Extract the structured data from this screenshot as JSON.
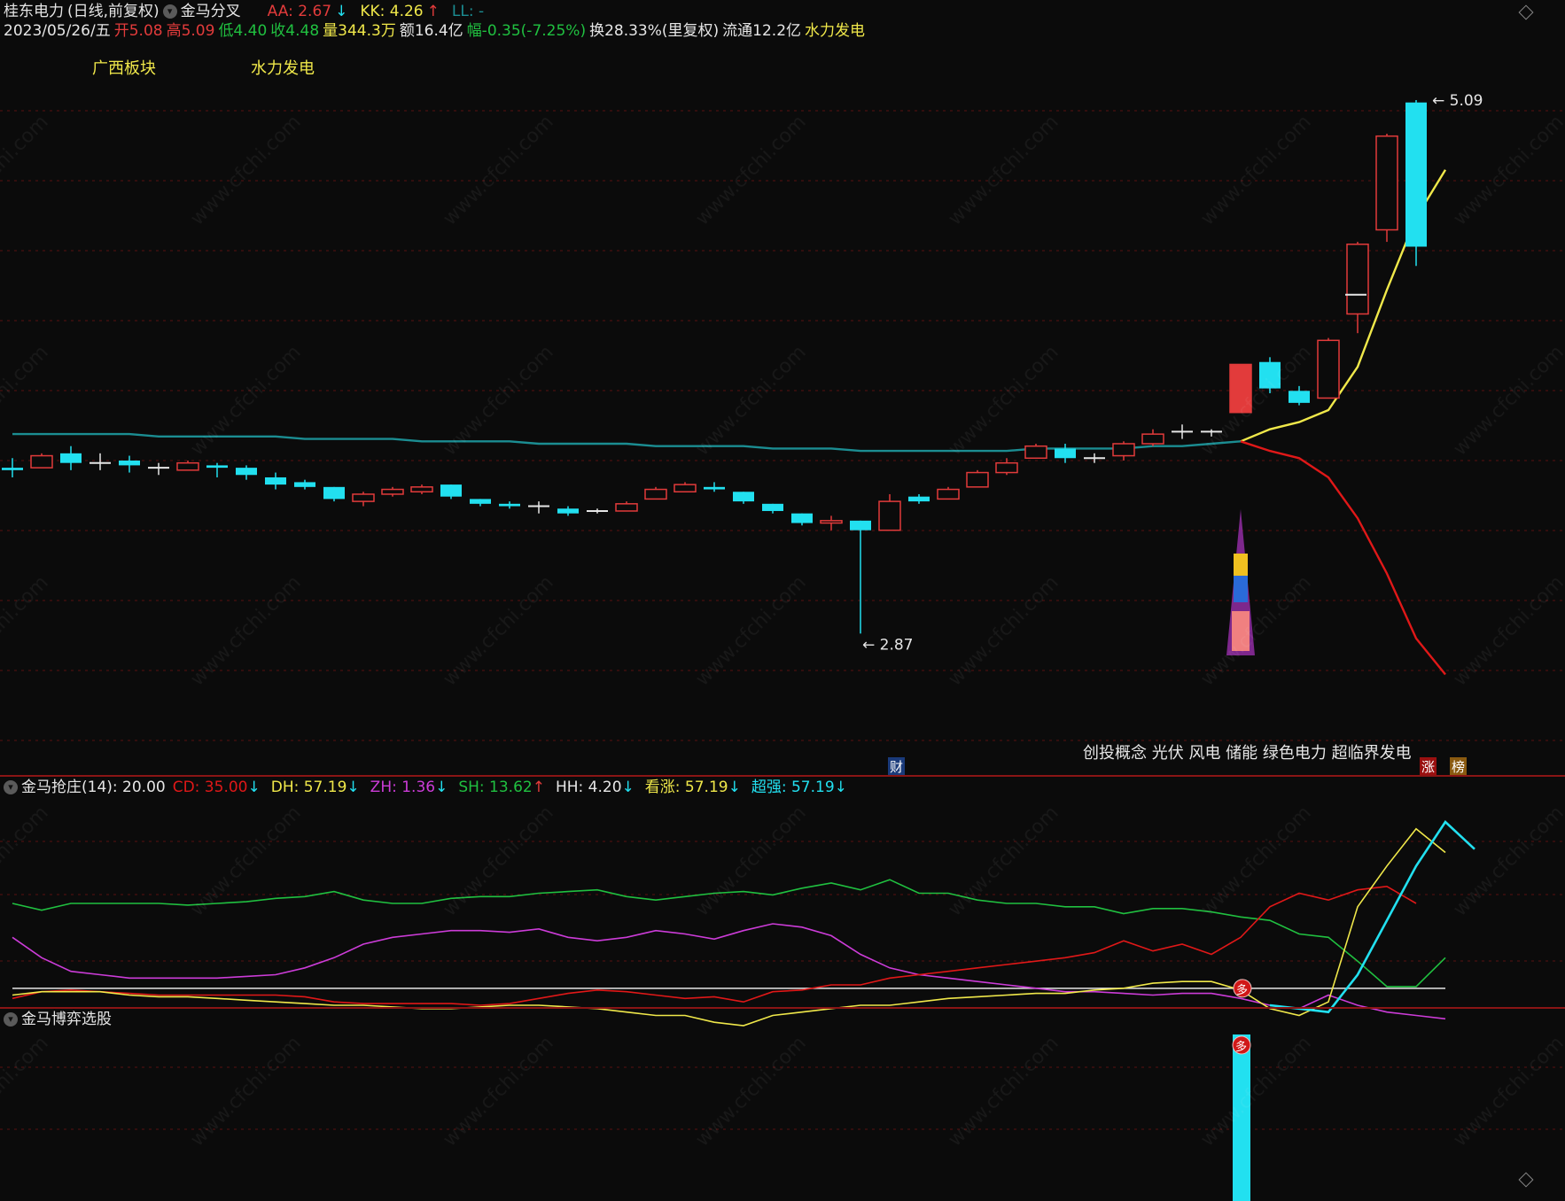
{
  "header": {
    "stock_name": "桂东电力",
    "period": "(日线,前复权)",
    "indicator_name": "金马分叉",
    "aa_label": "AA: 2.67",
    "kk_label": "KK: 4.26",
    "ll_label": "LL: -",
    "date": "2023/05/26/五",
    "open": "开5.08",
    "high": "高5.09",
    "low": "低4.40",
    "close": "收4.48",
    "volume": "量344.3万",
    "amount": "额16.4亿",
    "change": "幅-0.35(-7.25%)",
    "turnover": "换28.33%(里复权)",
    "float": "流通12.2亿",
    "sector": "水力发电"
  },
  "main": {
    "tag_region": "广西板块",
    "tag_industry": "水力发电",
    "concepts": "创投概念 光伏 风电 储能 绿色电力 超临界发电",
    "badge_cai": "财",
    "badge_zhang": "涨",
    "badge_bang": "榜",
    "high_label": "5.09",
    "low_label": "2.87"
  },
  "sub1": {
    "title": "金马抢庄(14)",
    "val": ": 20.00",
    "cd": "CD: 35.00",
    "dh": "DH: 57.19",
    "zh": "ZH: 1.36",
    "sh": "SH: 13.62",
    "hh": "HH: 4.20",
    "kz": "看涨: 57.19",
    "cq": "超强: 57.19",
    "marker": "多"
  },
  "sub2": {
    "title": "金马博弈选股",
    "marker": "多"
  },
  "watermark": "www.cfchi.com",
  "colors": {
    "up": "#e23b3b",
    "down": "#22e0f0",
    "yellow": "#f0e84a",
    "green": "#20c040",
    "magenta": "#cc3cd8",
    "teal": "#1b8d92",
    "red_line": "#e01818"
  },
  "chart_data": [
    {
      "type": "candlestick",
      "title": "桂东电力 (日线,前复权)",
      "x_count": 50,
      "ylim": [
        2.3,
        5.3
      ],
      "candles": [
        {
          "o": 3.56,
          "h": 3.6,
          "l": 3.52,
          "c": 3.55
        },
        {
          "o": 3.56,
          "h": 3.62,
          "l": 3.56,
          "c": 3.61
        },
        {
          "o": 3.62,
          "h": 3.65,
          "l": 3.55,
          "c": 3.58
        },
        {
          "o": 3.58,
          "h": 3.62,
          "l": 3.55,
          "c": 3.58
        },
        {
          "o": 3.59,
          "h": 3.61,
          "l": 3.54,
          "c": 3.57
        },
        {
          "o": 3.56,
          "h": 3.58,
          "l": 3.53,
          "c": 3.56
        },
        {
          "o": 3.55,
          "h": 3.59,
          "l": 3.55,
          "c": 3.58
        },
        {
          "o": 3.57,
          "h": 3.58,
          "l": 3.52,
          "c": 3.56
        },
        {
          "o": 3.56,
          "h": 3.57,
          "l": 3.51,
          "c": 3.53
        },
        {
          "o": 3.52,
          "h": 3.54,
          "l": 3.47,
          "c": 3.49
        },
        {
          "o": 3.5,
          "h": 3.51,
          "l": 3.47,
          "c": 3.48
        },
        {
          "o": 3.48,
          "h": 3.48,
          "l": 3.42,
          "c": 3.43
        },
        {
          "o": 3.42,
          "h": 3.46,
          "l": 3.4,
          "c": 3.45
        },
        {
          "o": 3.45,
          "h": 3.48,
          "l": 3.44,
          "c": 3.47
        },
        {
          "o": 3.46,
          "h": 3.49,
          "l": 3.45,
          "c": 3.48
        },
        {
          "o": 3.49,
          "h": 3.49,
          "l": 3.43,
          "c": 3.44
        },
        {
          "o": 3.43,
          "h": 3.43,
          "l": 3.4,
          "c": 3.41
        },
        {
          "o": 3.41,
          "h": 3.42,
          "l": 3.39,
          "c": 3.4
        },
        {
          "o": 3.4,
          "h": 3.42,
          "l": 3.37,
          "c": 3.4
        },
        {
          "o": 3.39,
          "h": 3.4,
          "l": 3.36,
          "c": 3.37
        },
        {
          "o": 3.38,
          "h": 3.39,
          "l": 3.37,
          "c": 3.38
        },
        {
          "o": 3.38,
          "h": 3.42,
          "l": 3.38,
          "c": 3.41
        },
        {
          "o": 3.43,
          "h": 3.48,
          "l": 3.43,
          "c": 3.47
        },
        {
          "o": 3.46,
          "h": 3.5,
          "l": 3.46,
          "c": 3.49
        },
        {
          "o": 3.48,
          "h": 3.5,
          "l": 3.46,
          "c": 3.47
        },
        {
          "o": 3.46,
          "h": 3.46,
          "l": 3.41,
          "c": 3.42
        },
        {
          "o": 3.41,
          "h": 3.41,
          "l": 3.37,
          "c": 3.38
        },
        {
          "o": 3.37,
          "h": 3.37,
          "l": 3.32,
          "c": 3.33
        },
        {
          "o": 3.33,
          "h": 3.36,
          "l": 3.3,
          "c": 3.34
        },
        {
          "o": 3.34,
          "h": 3.34,
          "l": 2.87,
          "c": 3.3
        },
        {
          "o": 3.3,
          "h": 3.45,
          "l": 3.3,
          "c": 3.42
        },
        {
          "o": 3.44,
          "h": 3.45,
          "l": 3.41,
          "c": 3.42
        },
        {
          "o": 3.43,
          "h": 3.48,
          "l": 3.43,
          "c": 3.47
        },
        {
          "o": 3.48,
          "h": 3.55,
          "l": 3.48,
          "c": 3.54
        },
        {
          "o": 3.54,
          "h": 3.6,
          "l": 3.53,
          "c": 3.58
        },
        {
          "o": 3.6,
          "h": 3.66,
          "l": 3.6,
          "c": 3.65
        },
        {
          "o": 3.64,
          "h": 3.66,
          "l": 3.58,
          "c": 3.6
        },
        {
          "o": 3.6,
          "h": 3.62,
          "l": 3.58,
          "c": 3.6
        },
        {
          "o": 3.61,
          "h": 3.67,
          "l": 3.59,
          "c": 3.66
        },
        {
          "o": 3.66,
          "h": 3.72,
          "l": 3.65,
          "c": 3.7
        },
        {
          "o": 3.71,
          "h": 3.74,
          "l": 3.68,
          "c": 3.71
        },
        {
          "o": 3.71,
          "h": 3.72,
          "l": 3.69,
          "c": 3.71
        },
        {
          "o": 3.79,
          "h": 3.99,
          "l": 3.79,
          "c": 3.99
        },
        {
          "o": 4.0,
          "h": 4.02,
          "l": 3.87,
          "c": 3.89
        },
        {
          "o": 3.88,
          "h": 3.9,
          "l": 3.82,
          "c": 3.83
        },
        {
          "o": 3.85,
          "h": 4.1,
          "l": 3.85,
          "c": 4.09
        },
        {
          "o": 4.2,
          "h": 4.5,
          "l": 4.12,
          "c": 4.49
        },
        {
          "o": 4.55,
          "h": 4.95,
          "l": 4.5,
          "c": 4.94
        },
        {
          "o": 5.08,
          "h": 5.09,
          "l": 4.4,
          "c": 4.48
        }
      ],
      "overlays": [
        {
          "name": "teal",
          "values": [
            3.7,
            3.7,
            3.7,
            3.7,
            3.7,
            3.69,
            3.69,
            3.69,
            3.69,
            3.69,
            3.68,
            3.68,
            3.68,
            3.68,
            3.67,
            3.67,
            3.67,
            3.67,
            3.66,
            3.66,
            3.66,
            3.66,
            3.65,
            3.65,
            3.65,
            3.65,
            3.64,
            3.64,
            3.64,
            3.63,
            3.63,
            3.63,
            3.63,
            3.63,
            3.63,
            3.64,
            3.64,
            3.64,
            3.64,
            3.65,
            3.65,
            3.66,
            3.67
          ]
        },
        {
          "name": "yellow",
          "start": 42,
          "values": [
            3.67,
            3.72,
            3.75,
            3.8,
            3.98,
            4.3,
            4.6,
            4.8
          ]
        },
        {
          "name": "red",
          "start": 42,
          "values": [
            3.67,
            3.63,
            3.6,
            3.52,
            3.35,
            3.12,
            2.85,
            2.7
          ]
        }
      ],
      "annotations": [
        "5.09",
        "2.87"
      ]
    },
    {
      "type": "line",
      "title": "金马抢庄(14)",
      "ylim": [
        -10,
        110
      ],
      "x_count": 50,
      "series": [
        {
          "name": "green",
          "values": [
            50,
            46,
            50,
            50,
            50,
            50,
            49,
            50,
            51,
            53,
            54,
            57,
            52,
            50,
            50,
            53,
            54,
            54,
            56,
            57,
            58,
            54,
            52,
            54,
            56,
            57,
            55,
            59,
            62,
            58,
            64,
            56,
            56,
            52,
            50,
            50,
            48,
            48,
            44,
            47,
            47,
            45,
            42,
            40,
            32,
            30,
            16,
            1,
            1,
            18
          ]
        },
        {
          "name": "magenta",
          "values": [
            30,
            18,
            10,
            8,
            6,
            6,
            6,
            6,
            7,
            8,
            12,
            18,
            26,
            30,
            32,
            34,
            34,
            33,
            35,
            30,
            28,
            30,
            34,
            32,
            29,
            34,
            38,
            36,
            31,
            20,
            12,
            8,
            6,
            4,
            2,
            0,
            -2,
            -2,
            -3,
            -4,
            -3,
            -3,
            -6,
            -10,
            -12,
            -4,
            -10,
            -14,
            -16,
            -18
          ]
        },
        {
          "name": "red",
          "values": [
            -6,
            -2,
            -1,
            -2,
            -3,
            -4,
            -4,
            -4,
            -4,
            -4,
            -5,
            -8,
            -9,
            -9,
            -9,
            -9,
            -10,
            -9,
            -6,
            -3,
            -1,
            -2,
            -4,
            -6,
            -5,
            -8,
            -2,
            -1,
            2,
            2,
            6,
            8,
            10,
            12,
            14,
            16,
            18,
            21,
            28,
            22,
            26,
            20,
            30,
            48,
            56,
            52,
            58,
            60,
            50
          ]
        },
        {
          "name": "yellow",
          "values": [
            -4,
            -2,
            -2,
            -2,
            -4,
            -5,
            -5,
            -6,
            -7,
            -8,
            -9,
            -10,
            -10,
            -11,
            -12,
            -12,
            -11,
            -10,
            -10,
            -11,
            -12,
            -14,
            -16,
            -16,
            -20,
            -22,
            -16,
            -14,
            -12,
            -10,
            -10,
            -8,
            -6,
            -5,
            -4,
            -3,
            -3,
            -1,
            0,
            3,
            4,
            4,
            -1,
            -12,
            -16,
            -8,
            48,
            72,
            94,
            80
          ]
        },
        {
          "name": "cyan",
          "start": 43,
          "values": [
            -10,
            -12,
            -14,
            8,
            40,
            72,
            98,
            82
          ]
        }
      ],
      "baseline": 0
    },
    {
      "type": "bar",
      "title": "金马博弈选股",
      "x_count": 50,
      "values_at": [
        {
          "index": 42,
          "value": 1
        }
      ]
    }
  ]
}
